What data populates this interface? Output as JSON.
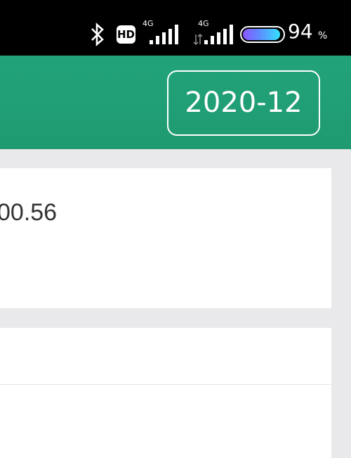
{
  "status_bar": {
    "network_a": "4G",
    "network_b": "4G",
    "hd_label": "HD",
    "battery_level": "94",
    "battery_unit": "%",
    "battery_fraction": 0.94
  },
  "header": {
    "month": "2020-12",
    "accent_color": "#22a37a"
  },
  "summary": {
    "amount": "00.56"
  }
}
